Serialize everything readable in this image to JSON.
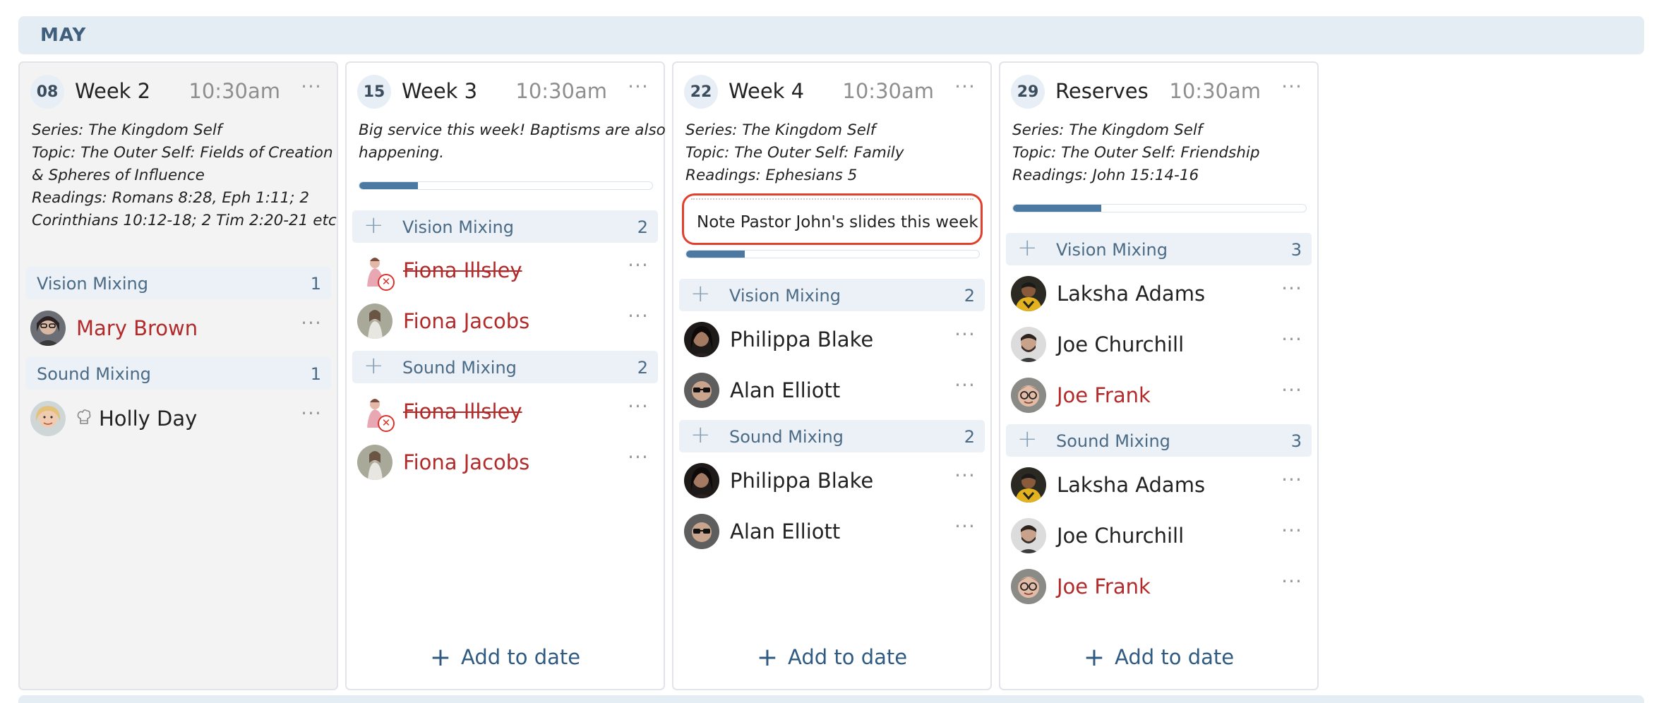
{
  "month": "MAY",
  "action_add": "Add to date",
  "columns": [
    {
      "date": "08",
      "week": "Week 2",
      "time": "10:30am",
      "desc": [
        "Series: The Kingdom Self",
        "Topic: The Outer Self: Fields of Creation",
        "& Spheres of Influence",
        "Readings: Romans 8:28, Eph 1:11; 2",
        "Corinthians 10:12-18; 2 Tim 2:20-21 etc"
      ],
      "roles": [
        {
          "name": "Vision Mixing",
          "count": "1",
          "people": [
            {
              "name": "Mary Brown"
            }
          ]
        },
        {
          "name": "Sound Mixing",
          "count": "1",
          "people": [
            {
              "name": "Holly Day"
            }
          ]
        }
      ]
    },
    {
      "date": "15",
      "week": "Week 3",
      "time": "10:30am",
      "desc": [
        "Big service this week! Baptisms are also",
        "happening."
      ],
      "progress": 0.2,
      "roles": [
        {
          "name": "Vision Mixing",
          "count": "2",
          "people": [
            {
              "name": "Fiona Illsley"
            },
            {
              "name": "Fiona Jacobs"
            }
          ]
        },
        {
          "name": "Sound Mixing",
          "count": "2",
          "people": [
            {
              "name": "Fiona Illsley"
            },
            {
              "name": "Fiona Jacobs"
            }
          ]
        }
      ]
    },
    {
      "date": "22",
      "week": "Week 4",
      "time": "10:30am",
      "desc": [
        "Series: The Kingdom Self",
        "Topic: The Outer Self: Family",
        "Readings: Ephesians 5"
      ],
      "note": "Note Pastor John's slides this week",
      "progress": 0.2,
      "roles": [
        {
          "name": "Vision Mixing",
          "count": "2",
          "people": [
            {
              "name": "Philippa Blake"
            },
            {
              "name": "Alan Elliott"
            }
          ]
        },
        {
          "name": "Sound Mixing",
          "count": "2",
          "people": [
            {
              "name": "Philippa Blake"
            },
            {
              "name": "Alan Elliott"
            }
          ]
        }
      ]
    },
    {
      "date": "29",
      "week": "Reserves",
      "time": "10:30am",
      "desc": [
        "Series: The Kingdom Self",
        "Topic: The Outer Self: Friendship",
        "Readings: John 15:14-16"
      ],
      "progress": 0.3,
      "roles": [
        {
          "name": "Vision Mixing",
          "count": "3",
          "people": [
            {
              "name": "Laksha Adams"
            },
            {
              "name": "Joe Churchill"
            },
            {
              "name": "Joe Frank"
            }
          ]
        },
        {
          "name": "Sound Mixing",
          "count": "3",
          "people": [
            {
              "name": "Laksha Adams"
            },
            {
              "name": "Joe Churchill"
            },
            {
              "name": "Joe Frank"
            }
          ]
        }
      ]
    }
  ],
  "colors": {
    "accent": "#4b79a1",
    "alert": "#b22a2a",
    "highlight": "#e0402c",
    "role_bg": "#ebf1f6"
  }
}
